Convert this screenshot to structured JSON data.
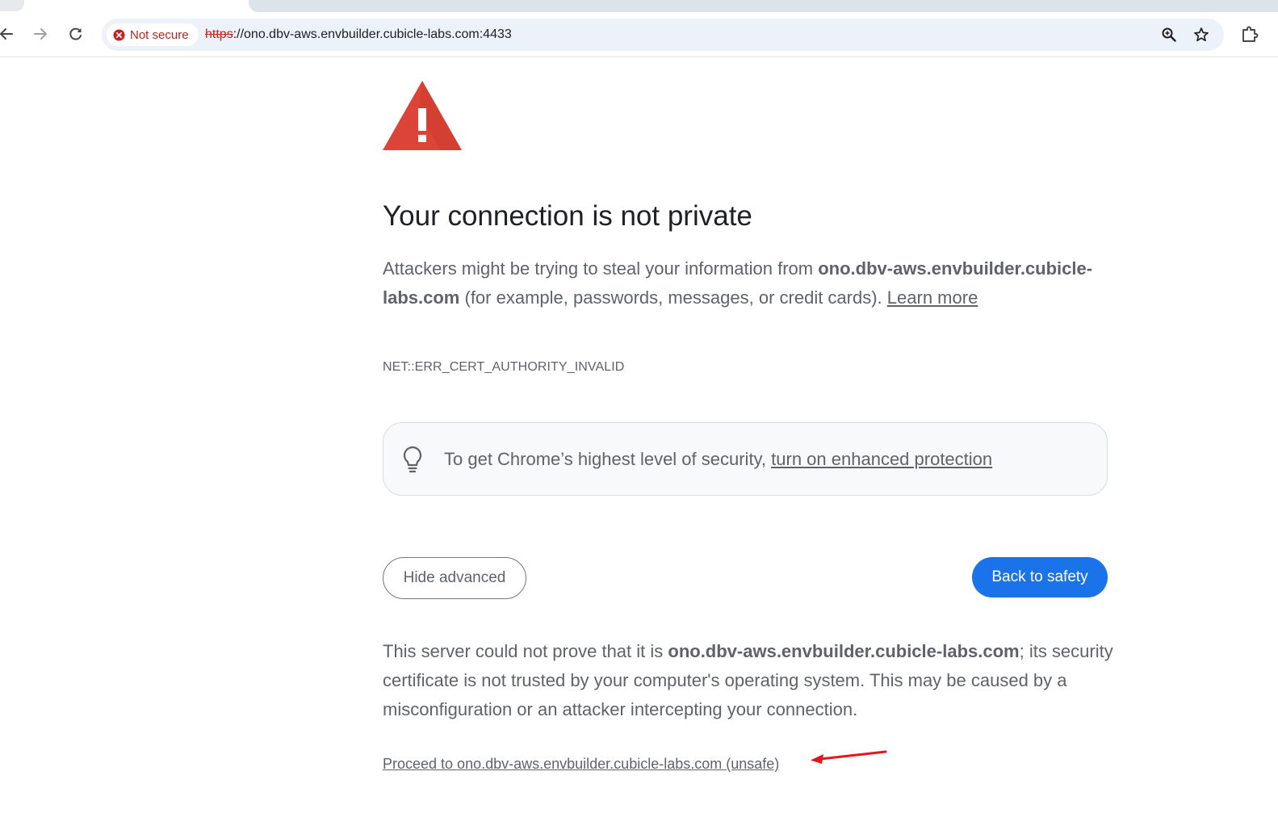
{
  "browser": {
    "security_chip": "Not secure",
    "url_scheme": "https",
    "url_rest": "://ono.dbv-aws.envbuilder.cubicle-labs.com:4433",
    "icons": {
      "back": "back-arrow-icon",
      "forward": "forward-arrow-icon",
      "reload": "reload-icon",
      "security": "error-circle-icon",
      "zoom": "zoom-icon",
      "bookmark": "star-icon",
      "extensions": "puzzle-icon"
    }
  },
  "page": {
    "headline": "Your connection is not private",
    "message_part1": "Attackers might be trying to steal your information from ",
    "host": "ono.dbv-aws.envbuilder.cubicle-labs.com",
    "message_part2": " (for example, passwords, messages, or credit cards). ",
    "learn_more": "Learn more",
    "error_code": "NET::ERR_CERT_AUTHORITY_INVALID",
    "enhanced_text": "To get Chrome’s highest level of security, ",
    "enhanced_link": "turn on enhanced protection",
    "hide_advanced": "Hide advanced",
    "back_to_safety": "Back to safety",
    "details_part1": "This server could not prove that it is ",
    "details_host": "ono.dbv-aws.envbuilder.cubicle-labs.com",
    "details_part2": "; its security certificate is not trusted by your computer's operating system. This may be caused by a misconfiguration or an attacker intercepting your connection.",
    "proceed_link": "Proceed to ono.dbv-aws.envbuilder.cubicle-labs.com (unsafe)"
  },
  "colors": {
    "warning_red": "#db4437",
    "primary_blue": "#1a73e8",
    "annotation_red": "#e8141c"
  }
}
